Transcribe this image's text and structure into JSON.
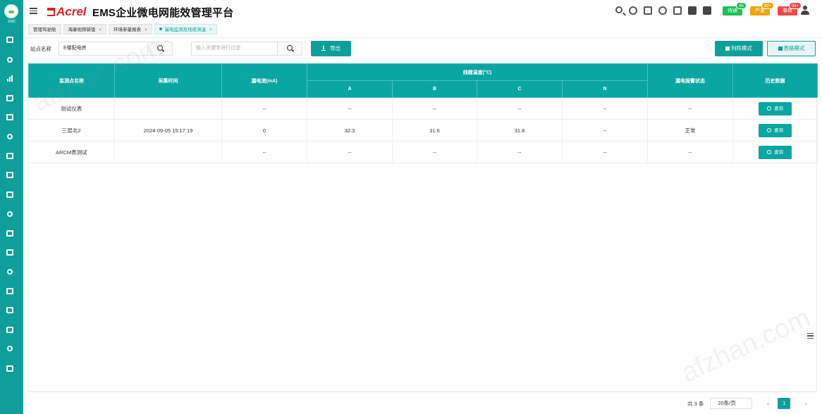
{
  "sidebar": {
    "logo_text": "ЕМС",
    "icon_names": [
      "folder-icon",
      "alarm-icon",
      "chart-bar-icon",
      "image-icon",
      "monitor-icon",
      "gear-icon",
      "grid-icon",
      "building-icon",
      "bulb-icon",
      "list-icon",
      "doc-icon",
      "plug-icon",
      "flag-icon",
      "table-icon",
      "map-icon",
      "home-icon",
      "edit-icon"
    ]
  },
  "header": {
    "brand": "Acrel",
    "platform_title": "EMS企业微电网能效管理平台",
    "pills": [
      {
        "label": "待通",
        "badge": "45",
        "color": "#18c155",
        "badge_color": "#18c155"
      },
      {
        "label": "严重",
        "badge": "99+",
        "color": "#f2a20c",
        "badge_color": "#f2a20c"
      },
      {
        "label": "事故",
        "badge": "99+",
        "color": "#e84a4a",
        "badge_color": "#e84a4a"
      }
    ]
  },
  "tabs": [
    {
      "label": "管理驾驶舱"
    },
    {
      "label": "海康视频新版"
    },
    {
      "label": "环境参量报表"
    },
    {
      "label": "漏电监测及线缆测温"
    }
  ],
  "search": {
    "station_label": "站点名称",
    "station_value": "E楼配电房",
    "filter_placeholder": "输入关键字进行过滤",
    "export_label": "导出",
    "card_mode_label": "列阵模式",
    "table_mode_label": "表格模式"
  },
  "table": {
    "headers": {
      "name": "监测点名称",
      "time": "采集时间",
      "leak": "漏电流(mA)",
      "temp_group": "线缆温度(°C)",
      "a": "A",
      "b": "B",
      "c": "C",
      "n": "N",
      "status": "漏电报警状态",
      "history": "历史数据"
    },
    "rows": [
      {
        "name": "测试仪表",
        "time": "",
        "leak": "--",
        "a": "--",
        "b": "--",
        "c": "--",
        "n": "--",
        "status": "--",
        "btn": "查询"
      },
      {
        "name": "三层北2",
        "time": "2024-09-05 15:17:19",
        "leak": "0",
        "a": "32.3",
        "b": "31.6",
        "c": "31.8",
        "n": "--",
        "status": "正常",
        "btn": "查询"
      },
      {
        "name": "ARCM表测试",
        "time": "",
        "leak": "--",
        "a": "--",
        "b": "--",
        "c": "--",
        "n": "--",
        "status": "--",
        "btn": "查询"
      }
    ]
  },
  "pager": {
    "total": "共 3 条",
    "page_size": "20条/页",
    "current_page": "1",
    "prev": "‹",
    "next": "›"
  },
  "watermark": "afzhan.com"
}
